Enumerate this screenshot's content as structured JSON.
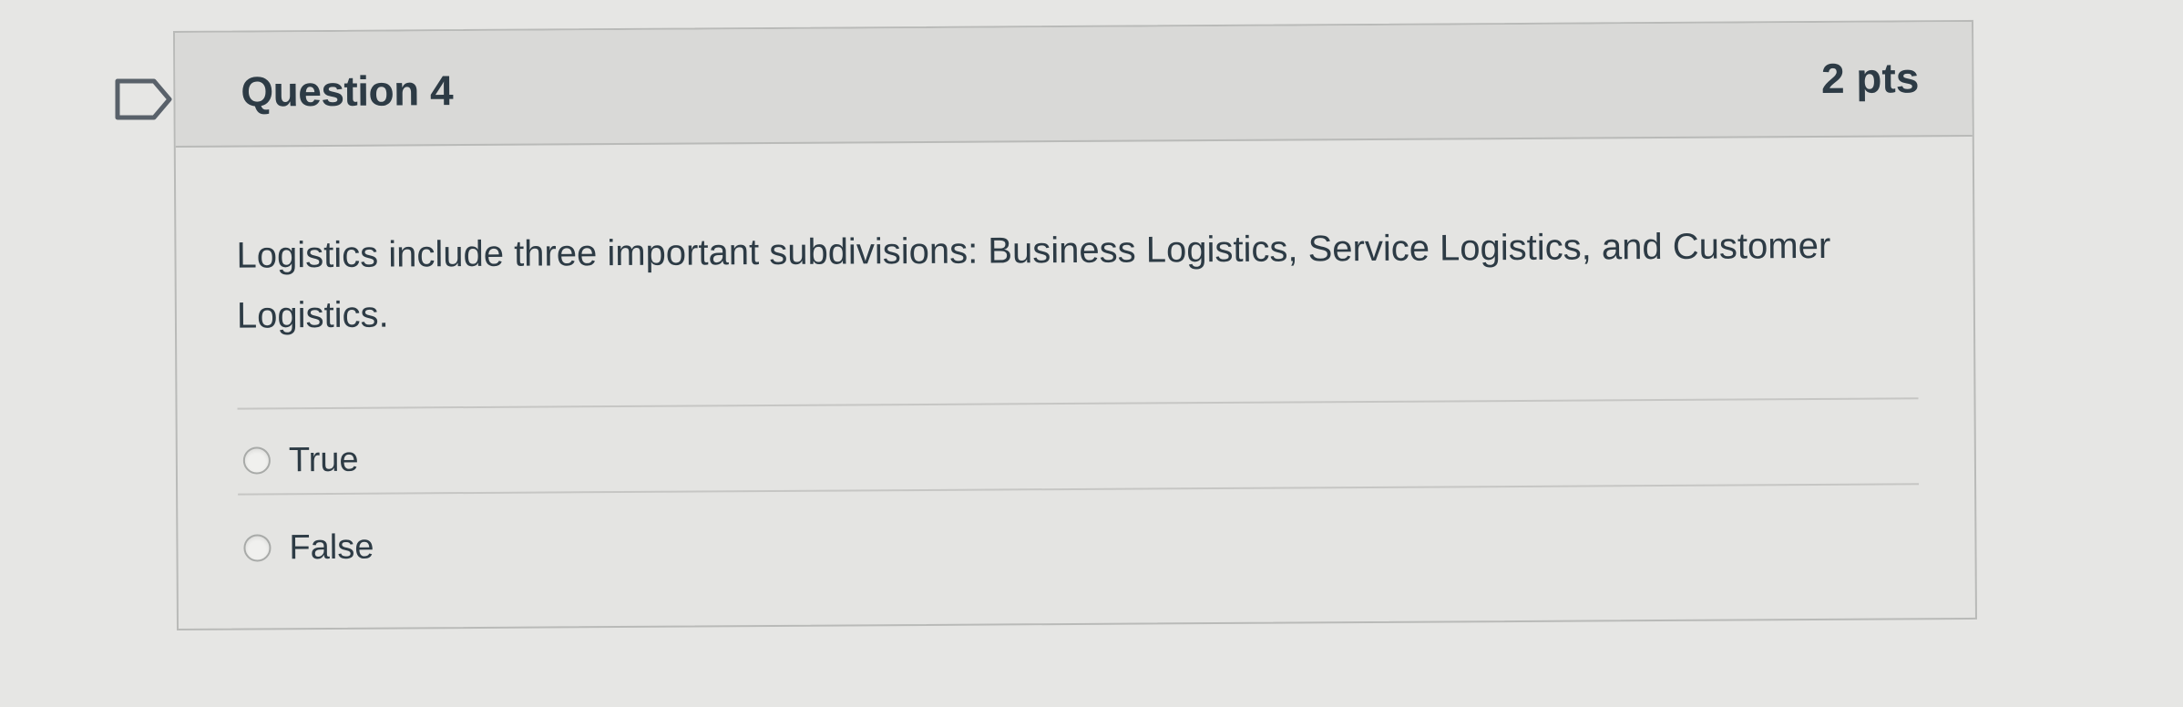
{
  "question": {
    "title": "Question 4",
    "points": "2 pts",
    "text": "Logistics include three important subdivisions: Business Logistics, Service Logistics, and Customer Logistics.",
    "flag_icon": "flag-outline-icon",
    "answers": [
      {
        "label": "True",
        "selected": false
      },
      {
        "label": "False",
        "selected": false
      }
    ]
  },
  "colors": {
    "text": "#2d3b45",
    "header_background": "#d9d9d7",
    "border": "#b9bab8"
  }
}
